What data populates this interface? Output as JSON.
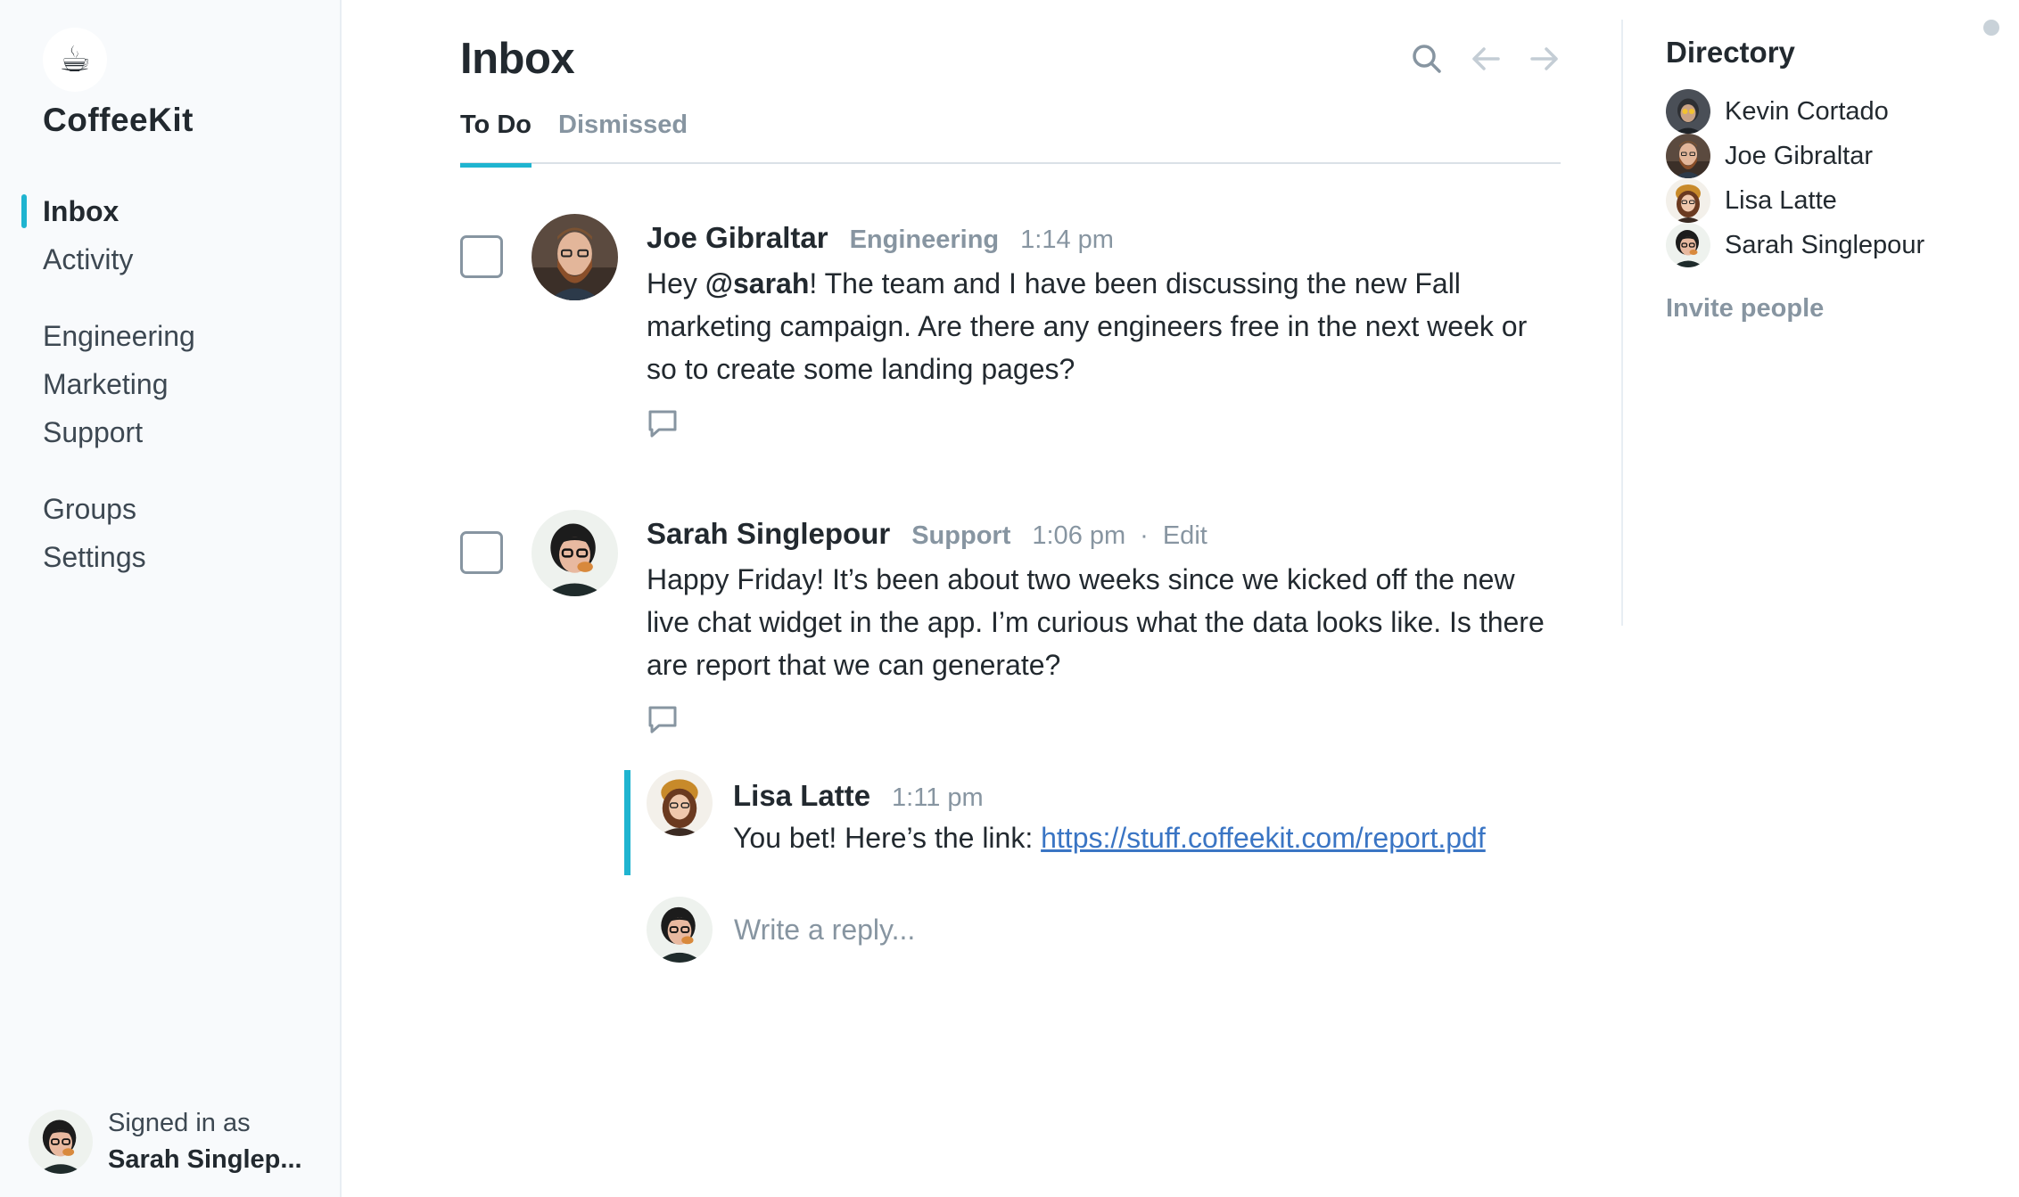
{
  "app": {
    "name": "CoffeeKit",
    "logo_icon": "coffee-cup-icon",
    "logo_glyph": "☕"
  },
  "sidebar": {
    "items": [
      {
        "label": "Inbox",
        "active": true
      },
      {
        "label": "Activity"
      },
      {
        "label": "Engineering"
      },
      {
        "label": "Marketing"
      },
      {
        "label": "Support"
      },
      {
        "label": "Groups"
      },
      {
        "label": "Settings"
      }
    ],
    "signed_in_label": "Signed in as",
    "signed_in_user": "Sarah Singlep..."
  },
  "header": {
    "title": "Inbox",
    "icons": [
      "search-icon",
      "arrow-left-icon",
      "arrow-right-icon"
    ]
  },
  "tabs": [
    {
      "label": "To Do",
      "active": true
    },
    {
      "label": "Dismissed"
    }
  ],
  "messages": [
    {
      "author": "Joe Gibraltar",
      "team": "Engineering",
      "time": "1:14 pm",
      "mention": "@sarah",
      "body_before": "Hey ",
      "body_after": "! The team and I have been discussing the new Fall marketing campaign. Are there any engineers free in the next week or so to create some landing pages?"
    },
    {
      "author": "Sarah Singlepour",
      "team": "Support",
      "time": "1:06 pm",
      "separator": "·",
      "edit_label": "Edit",
      "body": "Happy Friday! It’s been about two weeks since we kicked off the new live chat widget in the app. I’m curious what the data looks like. Is there are report that we can generate?",
      "reply": {
        "author": "Lisa Latte",
        "time": "1:11 pm",
        "text": "You bet! Here’s the link: ",
        "link": "https://stuff.coffeekit.com/report.pdf"
      },
      "reply_placeholder": "Write a reply..."
    }
  ],
  "directory": {
    "title": "Directory",
    "people": [
      "Kevin Cortado",
      "Joe Gibraltar",
      "Lisa Latte",
      "Sarah Singlepour"
    ],
    "invite_label": "Invite people"
  },
  "colors": {
    "accent": "#1fb4d0",
    "text": "#22292f",
    "muted": "#8795a1",
    "link": "#3a75c4",
    "sidebar_bg": "#f8fafc"
  }
}
